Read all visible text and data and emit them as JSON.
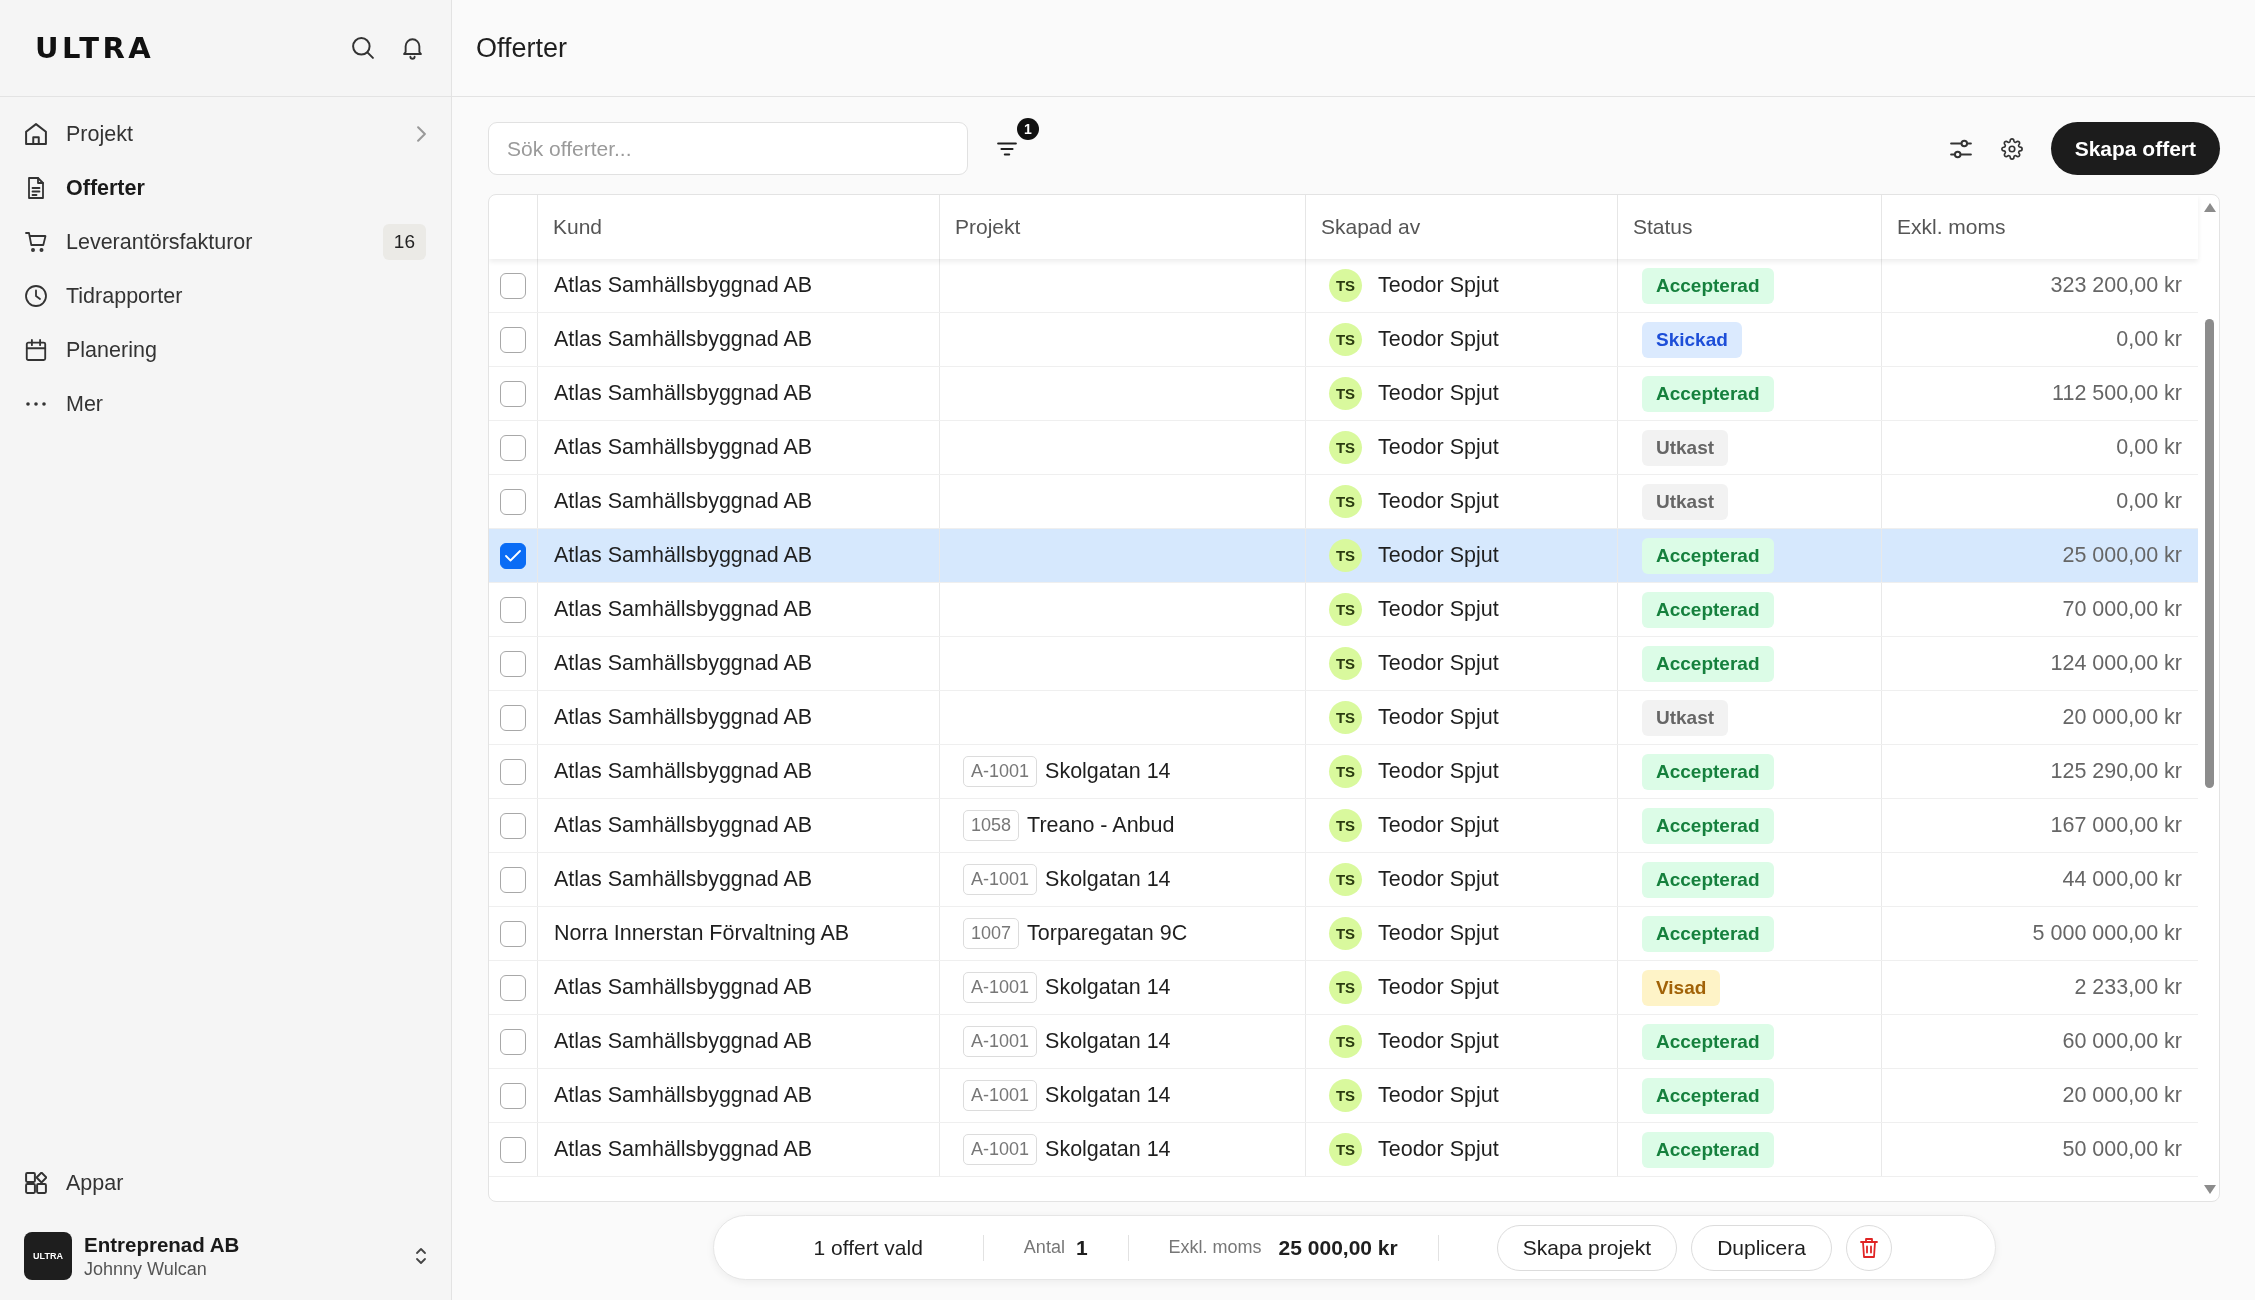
{
  "sidebar": {
    "logo": "ULTRA",
    "nav": [
      {
        "label": "Projekt",
        "selected": false,
        "has_submenu": true
      },
      {
        "label": "Offerter",
        "selected": true,
        "has_submenu": false
      },
      {
        "label": "Leverantörsfakturor",
        "selected": false,
        "has_submenu": false,
        "badge": "16"
      },
      {
        "label": "Tidrapporter",
        "selected": false,
        "has_submenu": false
      },
      {
        "label": "Planering",
        "selected": false,
        "has_submenu": false
      },
      {
        "label": "Mer",
        "selected": false,
        "has_submenu": false
      }
    ],
    "apps_item": {
      "label": "Appar"
    },
    "account": {
      "logo_text": "ULTRA",
      "company": "Entreprenad AB",
      "user": "Johnny Wulcan"
    }
  },
  "page": {
    "title": "Offerter"
  },
  "toolbar": {
    "search": {
      "placeholder": "Sök offerter..."
    },
    "filter_count": "1",
    "primary_button": "Skapa offert"
  },
  "table": {
    "columns": [
      "Kund",
      "Projekt",
      "Skapad av",
      "Status",
      "Exkl. moms"
    ],
    "rows": [
      {
        "selected": false,
        "customer": "Atlas Samhällsbyggnad AB",
        "created_by": {
          "initials": "TS",
          "name": "Teodor Spjut"
        },
        "status": {
          "label": "Accepterad",
          "kind": "accepted"
        },
        "amount": "323 200,00 kr"
      },
      {
        "selected": false,
        "customer": "Atlas Samhällsbyggnad AB",
        "created_by": {
          "initials": "TS",
          "name": "Teodor Spjut"
        },
        "status": {
          "label": "Skickad",
          "kind": "sent"
        },
        "amount": "0,00 kr"
      },
      {
        "selected": false,
        "customer": "Atlas Samhällsbyggnad AB",
        "created_by": {
          "initials": "TS",
          "name": "Teodor Spjut"
        },
        "status": {
          "label": "Accepterad",
          "kind": "accepted"
        },
        "amount": "112 500,00 kr"
      },
      {
        "selected": false,
        "customer": "Atlas Samhällsbyggnad AB",
        "created_by": {
          "initials": "TS",
          "name": "Teodor Spjut"
        },
        "status": {
          "label": "Utkast",
          "kind": "draft"
        },
        "amount": "0,00 kr"
      },
      {
        "selected": false,
        "customer": "Atlas Samhällsbyggnad AB",
        "created_by": {
          "initials": "TS",
          "name": "Teodor Spjut"
        },
        "status": {
          "label": "Utkast",
          "kind": "draft"
        },
        "amount": "0,00 kr"
      },
      {
        "selected": true,
        "customer": "Atlas Samhällsbyggnad AB",
        "created_by": {
          "initials": "TS",
          "name": "Teodor Spjut"
        },
        "status": {
          "label": "Accepterad",
          "kind": "accepted"
        },
        "amount": "25 000,00 kr"
      },
      {
        "selected": false,
        "customer": "Atlas Samhällsbyggnad AB",
        "created_by": {
          "initials": "TS",
          "name": "Teodor Spjut"
        },
        "status": {
          "label": "Accepterad",
          "kind": "accepted"
        },
        "amount": "70 000,00 kr"
      },
      {
        "selected": false,
        "customer": "Atlas Samhällsbyggnad AB",
        "created_by": {
          "initials": "TS",
          "name": "Teodor Spjut"
        },
        "status": {
          "label": "Accepterad",
          "kind": "accepted"
        },
        "amount": "124 000,00 kr"
      },
      {
        "selected": false,
        "customer": "Atlas Samhällsbyggnad AB",
        "created_by": {
          "initials": "TS",
          "name": "Teodor Spjut"
        },
        "status": {
          "label": "Utkast",
          "kind": "draft"
        },
        "amount": "20 000,00 kr"
      },
      {
        "selected": false,
        "customer": "Atlas Samhällsbyggnad AB",
        "project": {
          "code": "A-1001",
          "name": "Skolgatan 14"
        },
        "created_by": {
          "initials": "TS",
          "name": "Teodor Spjut"
        },
        "status": {
          "label": "Accepterad",
          "kind": "accepted"
        },
        "amount": "125 290,00 kr"
      },
      {
        "selected": false,
        "customer": "Atlas Samhällsbyggnad AB",
        "project": {
          "code": "1058",
          "name": "Treano - Anbud"
        },
        "created_by": {
          "initials": "TS",
          "name": "Teodor Spjut"
        },
        "status": {
          "label": "Accepterad",
          "kind": "accepted"
        },
        "amount": "167 000,00 kr"
      },
      {
        "selected": false,
        "customer": "Atlas Samhällsbyggnad AB",
        "project": {
          "code": "A-1001",
          "name": "Skolgatan 14"
        },
        "created_by": {
          "initials": "TS",
          "name": "Teodor Spjut"
        },
        "status": {
          "label": "Accepterad",
          "kind": "accepted"
        },
        "amount": "44 000,00 kr"
      },
      {
        "selected": false,
        "customer": "Norra Innerstan Förvaltning AB",
        "project": {
          "code": "1007",
          "name": "Torparegatan 9C"
        },
        "created_by": {
          "initials": "TS",
          "name": "Teodor Spjut"
        },
        "status": {
          "label": "Accepterad",
          "kind": "accepted"
        },
        "amount": "5 000 000,00 kr"
      },
      {
        "selected": false,
        "customer": "Atlas Samhällsbyggnad AB",
        "project": {
          "code": "A-1001",
          "name": "Skolgatan 14"
        },
        "created_by": {
          "initials": "TS",
          "name": "Teodor Spjut"
        },
        "status": {
          "label": "Visad",
          "kind": "viewed"
        },
        "amount": "2 233,00 kr"
      },
      {
        "selected": false,
        "customer": "Atlas Samhällsbyggnad AB",
        "project": {
          "code": "A-1001",
          "name": "Skolgatan 14"
        },
        "created_by": {
          "initials": "TS",
          "name": "Teodor Spjut"
        },
        "status": {
          "label": "Accepterad",
          "kind": "accepted"
        },
        "amount": "60 000,00 kr"
      },
      {
        "selected": false,
        "customer": "Atlas Samhällsbyggnad AB",
        "project": {
          "code": "A-1001",
          "name": "Skolgatan 14"
        },
        "created_by": {
          "initials": "TS",
          "name": "Teodor Spjut"
        },
        "status": {
          "label": "Accepterad",
          "kind": "accepted"
        },
        "amount": "20 000,00 kr"
      },
      {
        "selected": false,
        "customer": "Atlas Samhällsbyggnad AB",
        "project": {
          "code": "A-1001",
          "name": "Skolgatan 14"
        },
        "created_by": {
          "initials": "TS",
          "name": "Teodor Spjut"
        },
        "status": {
          "label": "Accepterad",
          "kind": "accepted"
        },
        "amount": "50 000,00 kr"
      }
    ]
  },
  "selection_bar": {
    "summary": "1 offert vald",
    "count_label": "Antal",
    "count": "1",
    "amount_label": "Exkl. moms",
    "amount": "25 000,00 kr",
    "buttons": [
      "Skapa projekt",
      "Duplicera"
    ]
  }
}
